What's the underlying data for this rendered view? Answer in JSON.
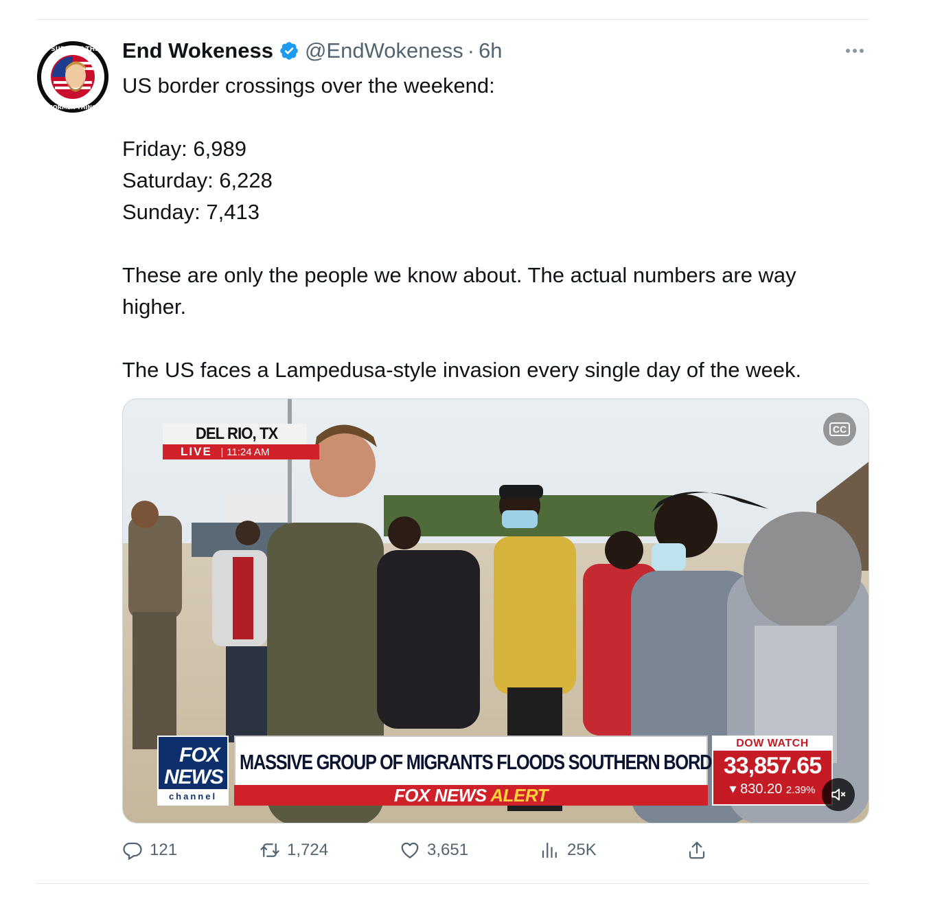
{
  "author": {
    "display_name": "End Wokeness",
    "handle": "@EndWokeness",
    "separator": "·",
    "time": "6h",
    "avatar_text_top": "I SUPPORT THE",
    "avatar_text_bottom": "FORMER THING"
  },
  "tweet": {
    "line1": "US border crossings over the weekend:",
    "line2": "Friday: 6,989",
    "line3": "Saturday: 6,228",
    "line4": "Sunday: 7,413",
    "line5": "These are only the people we know about. The actual numbers are way higher.",
    "line6": "The US faces a Lampedusa-style invasion every single day of the week."
  },
  "media": {
    "location": "DEL RIO, TX",
    "live_label": "LIVE",
    "live_time": "11:24 AM",
    "live_divider": "|",
    "cc_label": "CC",
    "logo_line1": "FOX",
    "logo_line2": "NEWS",
    "logo_line3": "channel",
    "headline": "MASSIVE GROUP OF MIGRANTS FLOODS SOUTHERN BORDER",
    "alert_prefix": "FOX NEWS ",
    "alert_word": "ALERT",
    "dow_title": "DOW WATCH",
    "dow_value": "33,857.65",
    "dow_change": "830.20",
    "dow_pct": "2.39%"
  },
  "actions": {
    "replies": "121",
    "retweets": "1,724",
    "likes": "3,651",
    "views": "25K"
  },
  "colors": {
    "verified": "#1d9bf0",
    "secondary_text": "#536471",
    "fox_red": "#d0202a",
    "fox_blue": "#0d2f6b"
  },
  "icons": {
    "verified": "verified-badge-icon",
    "more": "more-dots-icon",
    "reply": "reply-bubble-icon",
    "retweet": "retweet-arrows-icon",
    "like": "heart-icon",
    "views": "views-bar-chart-icon",
    "share": "share-upload-icon",
    "cc": "closed-captions-icon",
    "mute": "speaker-muted-icon"
  }
}
